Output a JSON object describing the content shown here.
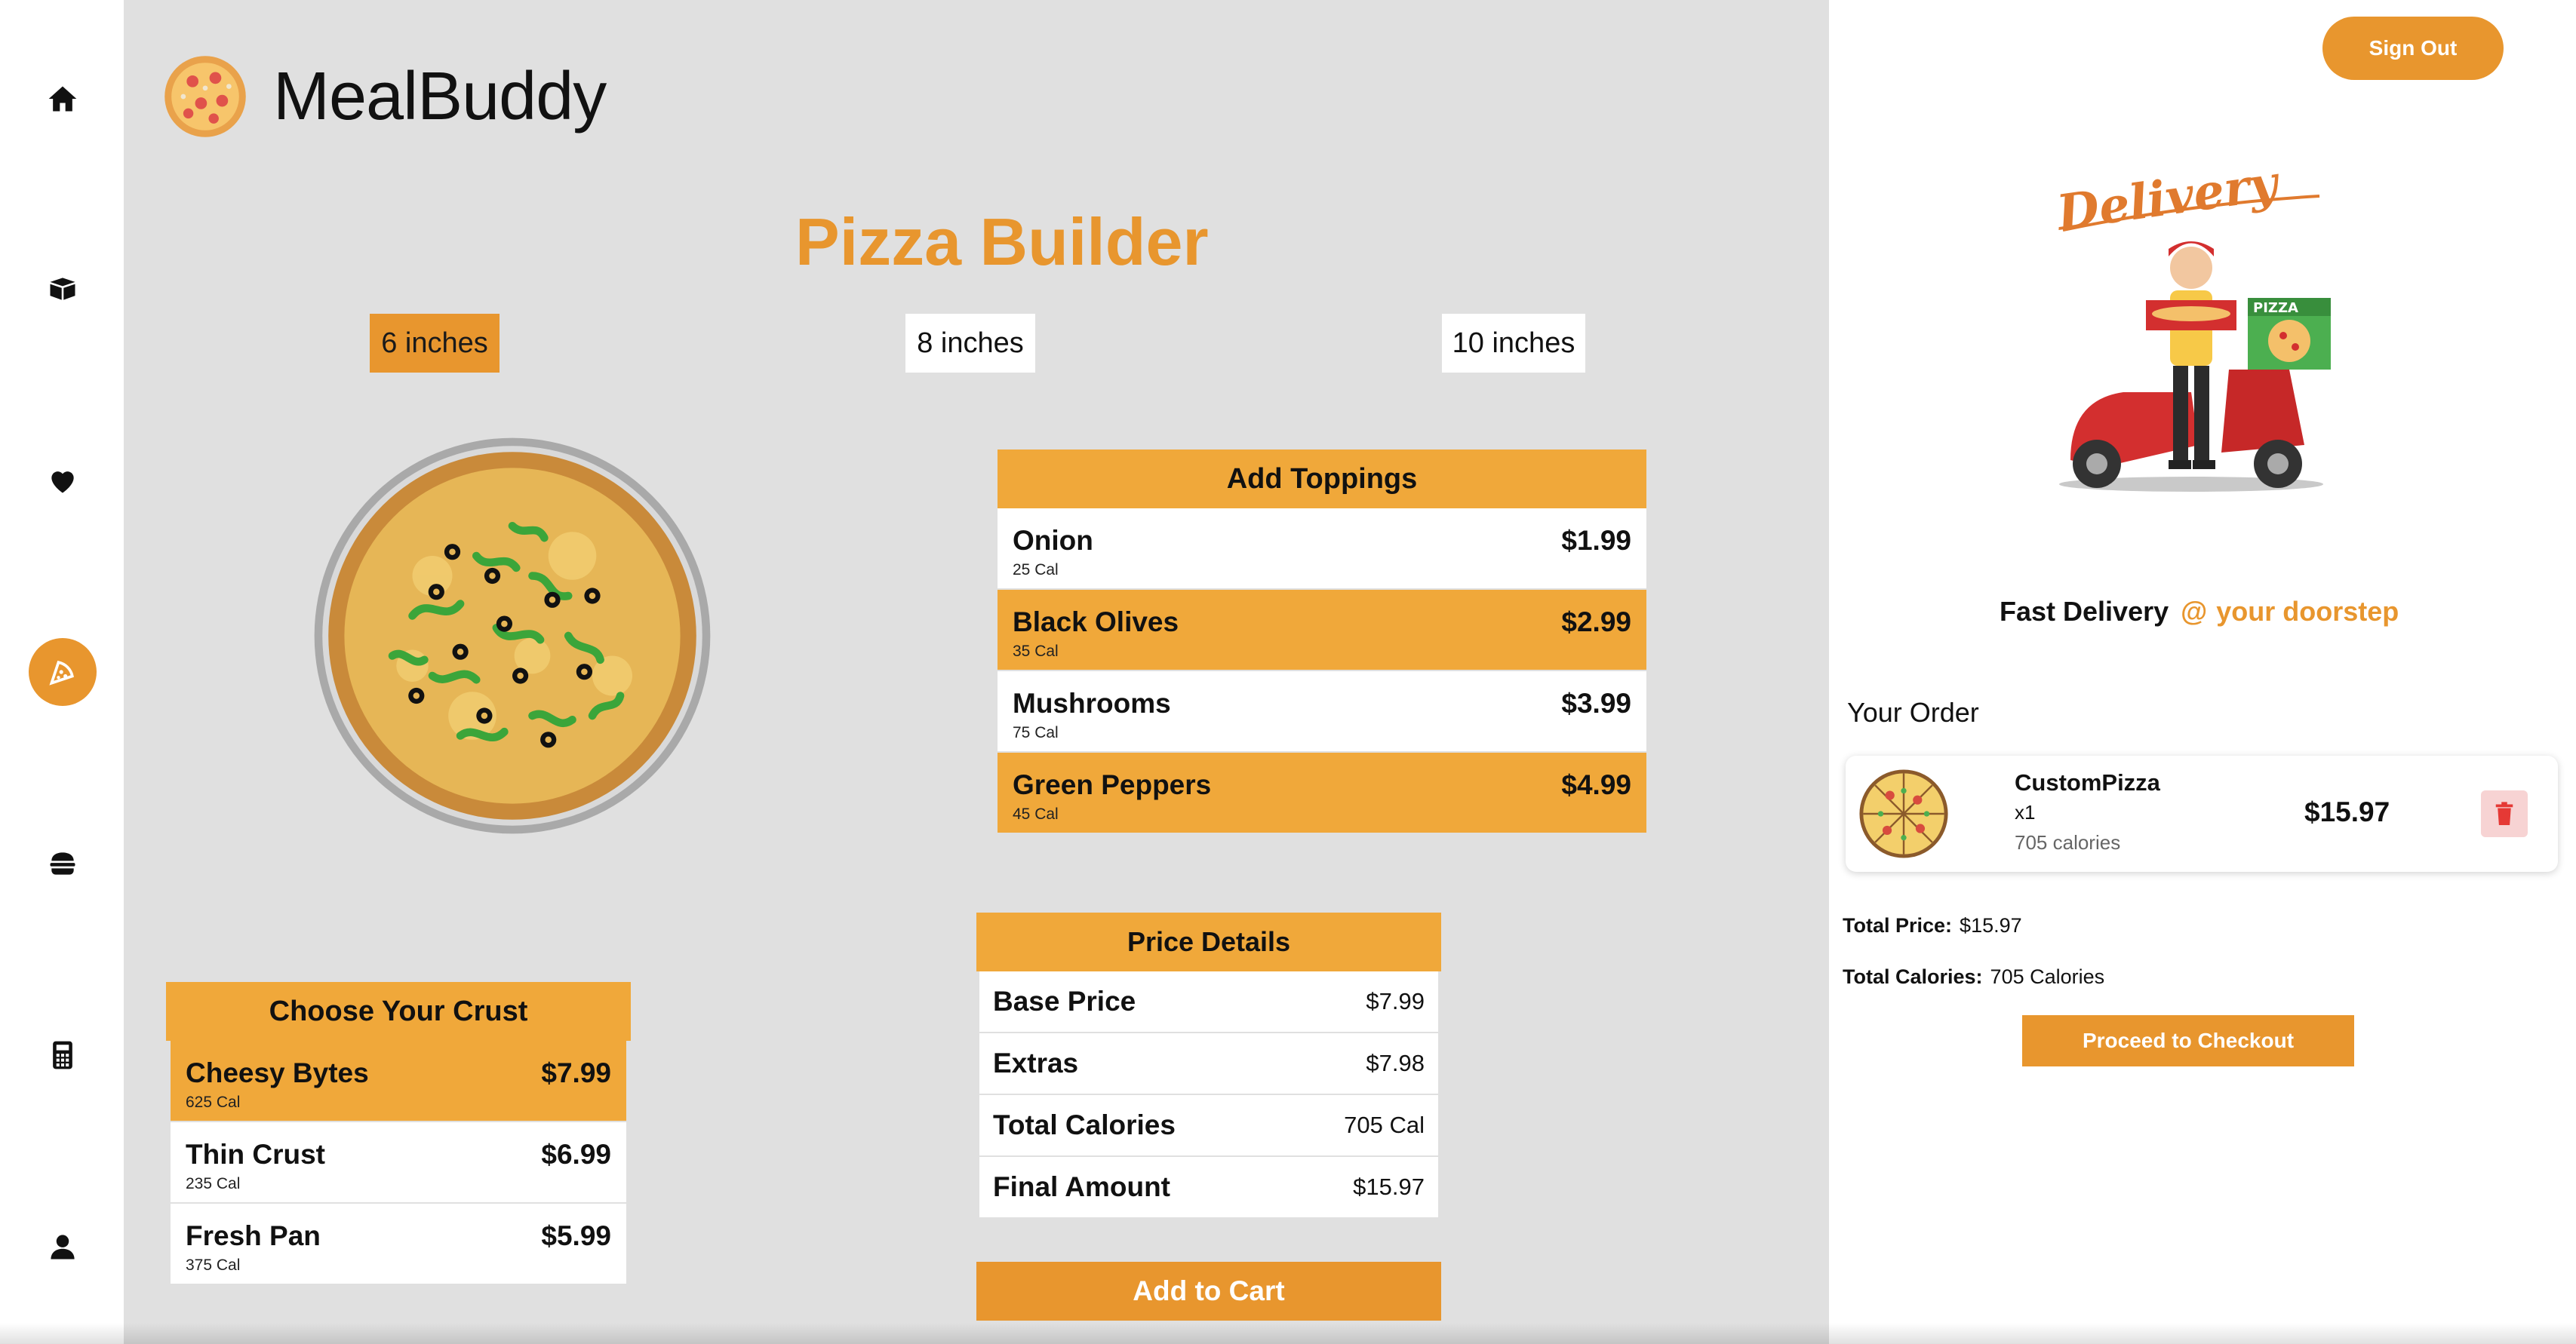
{
  "app": {
    "name": "MealBuddy"
  },
  "nav": {
    "items": [
      {
        "icon": "home-icon"
      },
      {
        "icon": "box-icon"
      },
      {
        "icon": "heart-icon"
      },
      {
        "icon": "pizza-icon",
        "active": true
      },
      {
        "icon": "burger-icon"
      },
      {
        "icon": "calculator-icon"
      },
      {
        "icon": "user-icon"
      }
    ]
  },
  "builder": {
    "title": "Pizza Builder",
    "sizes": [
      {
        "label": "6 inches",
        "selected": true
      },
      {
        "label": "8 inches",
        "selected": false
      },
      {
        "label": "10 inches",
        "selected": false
      }
    ]
  },
  "toppings": {
    "header": "Add Toppings",
    "items": [
      {
        "name": "Onion",
        "cal": "25 Cal",
        "price": "$1.99",
        "selected": false
      },
      {
        "name": "Black Olives",
        "cal": "35 Cal",
        "price": "$2.99",
        "selected": true
      },
      {
        "name": "Mushrooms",
        "cal": "75 Cal",
        "price": "$3.99",
        "selected": false
      },
      {
        "name": "Green Peppers",
        "cal": "45 Cal",
        "price": "$4.99",
        "selected": true
      }
    ]
  },
  "crust": {
    "header": "Choose Your Crust",
    "items": [
      {
        "name": "Cheesy Bytes",
        "cal": "625 Cal",
        "price": "$7.99",
        "selected": true
      },
      {
        "name": "Thin Crust",
        "cal": "235 Cal",
        "price": "$6.99",
        "selected": false
      },
      {
        "name": "Fresh Pan",
        "cal": "375 Cal",
        "price": "$5.99",
        "selected": false
      }
    ]
  },
  "price_details": {
    "header": "Price Details",
    "rows": [
      {
        "label": "Base Price",
        "value": "$7.99"
      },
      {
        "label": "Extras",
        "value": "$7.98"
      },
      {
        "label": "Total Calories",
        "value": "705 Cal"
      },
      {
        "label": "Final Amount",
        "value": "$15.97"
      }
    ],
    "add_to_cart": "Add to Cart"
  },
  "right": {
    "sign_out": "Sign Out",
    "illustration_text": "Delivery",
    "box_text": "PIZZA",
    "tagline": {
      "main": "Fast Delivery",
      "at": "@",
      "rest": "your doorstep"
    },
    "your_order_title": "Your Order",
    "order": {
      "name": "CustomPizza",
      "qty": "x1",
      "calories": "705 calories",
      "price": "$15.97"
    },
    "total_price_label": "Total Price:",
    "total_price_value": "$15.97",
    "total_cal_label": "Total Calories:",
    "total_cal_value": "705 Calories",
    "checkout": "Proceed to Checkout"
  },
  "colors": {
    "accent": "#E8962E",
    "header": "#F0A83A",
    "main_bg": "#E0E0E0"
  }
}
